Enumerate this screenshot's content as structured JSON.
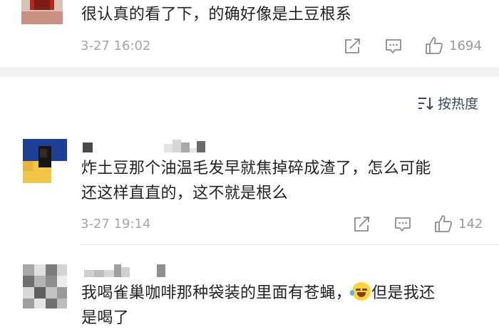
{
  "comments": [
    {
      "text_lines": [
        "很认真的看了下，的确好像是土豆根系"
      ],
      "time": "3-27 16:02",
      "likes": "1694"
    },
    {
      "text_lines": [
        "炸土豆那个油温毛发早就焦掉碎成渣了，怎么可能",
        "还这样直直的，这不就是根么"
      ],
      "time": "3-27 19:14",
      "likes": "142"
    },
    {
      "text_line1_before_emoji": "我喝雀巢咖啡那种袋装的里面有苍蝇，",
      "text_line1_after_emoji": "但是我还",
      "text_line2": "是喝了",
      "emoji_name": "laugh-cry-emoji"
    }
  ],
  "sort": {
    "label": "按热度",
    "icon": "sort-icon"
  },
  "icons": {
    "share": "share-icon",
    "comment": "comment-icon",
    "like": "thumbs-up-icon"
  },
  "colors": {
    "text": "#222222",
    "meta": "#a6a6a6",
    "sort_label": "#3a4a64",
    "divider": "#f2f2f2",
    "emoji": "#ffd43b"
  }
}
